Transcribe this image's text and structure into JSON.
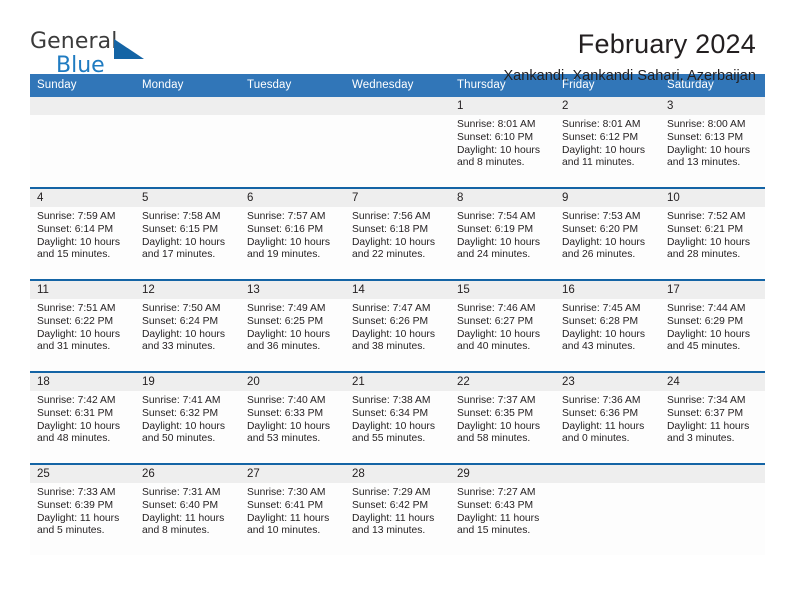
{
  "brand": {
    "line1": "General",
    "line2": "Blue",
    "triangle_color": "#1464a5",
    "blue_color": "#1f7bc1"
  },
  "header": {
    "title": "February 2024",
    "subtitle": "Xankandi, Xankandi Sahari, Azerbaijan"
  },
  "colors": {
    "header_blue": "#3176b8",
    "row_divider": "#1464a5",
    "daynum_band": "#eeeeee",
    "text": "#231f20"
  },
  "weekday_headers": [
    "Sunday",
    "Monday",
    "Tuesday",
    "Wednesday",
    "Thursday",
    "Friday",
    "Saturday"
  ],
  "weeks": [
    [
      {
        "day": "",
        "sunrise": "",
        "sunset": "",
        "daylight1": "",
        "daylight2": "",
        "blank": true
      },
      {
        "day": "",
        "sunrise": "",
        "sunset": "",
        "daylight1": "",
        "daylight2": "",
        "blank": true
      },
      {
        "day": "",
        "sunrise": "",
        "sunset": "",
        "daylight1": "",
        "daylight2": "",
        "blank": true
      },
      {
        "day": "",
        "sunrise": "",
        "sunset": "",
        "daylight1": "",
        "daylight2": "",
        "blank": true
      },
      {
        "day": "1",
        "sunrise": "Sunrise: 8:01 AM",
        "sunset": "Sunset: 6:10 PM",
        "daylight1": "Daylight: 10 hours",
        "daylight2": "and 8 minutes."
      },
      {
        "day": "2",
        "sunrise": "Sunrise: 8:01 AM",
        "sunset": "Sunset: 6:12 PM",
        "daylight1": "Daylight: 10 hours",
        "daylight2": "and 11 minutes."
      },
      {
        "day": "3",
        "sunrise": "Sunrise: 8:00 AM",
        "sunset": "Sunset: 6:13 PM",
        "daylight1": "Daylight: 10 hours",
        "daylight2": "and 13 minutes."
      }
    ],
    [
      {
        "day": "4",
        "sunrise": "Sunrise: 7:59 AM",
        "sunset": "Sunset: 6:14 PM",
        "daylight1": "Daylight: 10 hours",
        "daylight2": "and 15 minutes."
      },
      {
        "day": "5",
        "sunrise": "Sunrise: 7:58 AM",
        "sunset": "Sunset: 6:15 PM",
        "daylight1": "Daylight: 10 hours",
        "daylight2": "and 17 minutes."
      },
      {
        "day": "6",
        "sunrise": "Sunrise: 7:57 AM",
        "sunset": "Sunset: 6:16 PM",
        "daylight1": "Daylight: 10 hours",
        "daylight2": "and 19 minutes."
      },
      {
        "day": "7",
        "sunrise": "Sunrise: 7:56 AM",
        "sunset": "Sunset: 6:18 PM",
        "daylight1": "Daylight: 10 hours",
        "daylight2": "and 22 minutes."
      },
      {
        "day": "8",
        "sunrise": "Sunrise: 7:54 AM",
        "sunset": "Sunset: 6:19 PM",
        "daylight1": "Daylight: 10 hours",
        "daylight2": "and 24 minutes."
      },
      {
        "day": "9",
        "sunrise": "Sunrise: 7:53 AM",
        "sunset": "Sunset: 6:20 PM",
        "daylight1": "Daylight: 10 hours",
        "daylight2": "and 26 minutes."
      },
      {
        "day": "10",
        "sunrise": "Sunrise: 7:52 AM",
        "sunset": "Sunset: 6:21 PM",
        "daylight1": "Daylight: 10 hours",
        "daylight2": "and 28 minutes."
      }
    ],
    [
      {
        "day": "11",
        "sunrise": "Sunrise: 7:51 AM",
        "sunset": "Sunset: 6:22 PM",
        "daylight1": "Daylight: 10 hours",
        "daylight2": "and 31 minutes."
      },
      {
        "day": "12",
        "sunrise": "Sunrise: 7:50 AM",
        "sunset": "Sunset: 6:24 PM",
        "daylight1": "Daylight: 10 hours",
        "daylight2": "and 33 minutes."
      },
      {
        "day": "13",
        "sunrise": "Sunrise: 7:49 AM",
        "sunset": "Sunset: 6:25 PM",
        "daylight1": "Daylight: 10 hours",
        "daylight2": "and 36 minutes."
      },
      {
        "day": "14",
        "sunrise": "Sunrise: 7:47 AM",
        "sunset": "Sunset: 6:26 PM",
        "daylight1": "Daylight: 10 hours",
        "daylight2": "and 38 minutes."
      },
      {
        "day": "15",
        "sunrise": "Sunrise: 7:46 AM",
        "sunset": "Sunset: 6:27 PM",
        "daylight1": "Daylight: 10 hours",
        "daylight2": "and 40 minutes."
      },
      {
        "day": "16",
        "sunrise": "Sunrise: 7:45 AM",
        "sunset": "Sunset: 6:28 PM",
        "daylight1": "Daylight: 10 hours",
        "daylight2": "and 43 minutes."
      },
      {
        "day": "17",
        "sunrise": "Sunrise: 7:44 AM",
        "sunset": "Sunset: 6:29 PM",
        "daylight1": "Daylight: 10 hours",
        "daylight2": "and 45 minutes."
      }
    ],
    [
      {
        "day": "18",
        "sunrise": "Sunrise: 7:42 AM",
        "sunset": "Sunset: 6:31 PM",
        "daylight1": "Daylight: 10 hours",
        "daylight2": "and 48 minutes."
      },
      {
        "day": "19",
        "sunrise": "Sunrise: 7:41 AM",
        "sunset": "Sunset: 6:32 PM",
        "daylight1": "Daylight: 10 hours",
        "daylight2": "and 50 minutes."
      },
      {
        "day": "20",
        "sunrise": "Sunrise: 7:40 AM",
        "sunset": "Sunset: 6:33 PM",
        "daylight1": "Daylight: 10 hours",
        "daylight2": "and 53 minutes."
      },
      {
        "day": "21",
        "sunrise": "Sunrise: 7:38 AM",
        "sunset": "Sunset: 6:34 PM",
        "daylight1": "Daylight: 10 hours",
        "daylight2": "and 55 minutes."
      },
      {
        "day": "22",
        "sunrise": "Sunrise: 7:37 AM",
        "sunset": "Sunset: 6:35 PM",
        "daylight1": "Daylight: 10 hours",
        "daylight2": "and 58 minutes."
      },
      {
        "day": "23",
        "sunrise": "Sunrise: 7:36 AM",
        "sunset": "Sunset: 6:36 PM",
        "daylight1": "Daylight: 11 hours",
        "daylight2": "and 0 minutes."
      },
      {
        "day": "24",
        "sunrise": "Sunrise: 7:34 AM",
        "sunset": "Sunset: 6:37 PM",
        "daylight1": "Daylight: 11 hours",
        "daylight2": "and 3 minutes."
      }
    ],
    [
      {
        "day": "25",
        "sunrise": "Sunrise: 7:33 AM",
        "sunset": "Sunset: 6:39 PM",
        "daylight1": "Daylight: 11 hours",
        "daylight2": "and 5 minutes."
      },
      {
        "day": "26",
        "sunrise": "Sunrise: 7:31 AM",
        "sunset": "Sunset: 6:40 PM",
        "daylight1": "Daylight: 11 hours",
        "daylight2": "and 8 minutes."
      },
      {
        "day": "27",
        "sunrise": "Sunrise: 7:30 AM",
        "sunset": "Sunset: 6:41 PM",
        "daylight1": "Daylight: 11 hours",
        "daylight2": "and 10 minutes."
      },
      {
        "day": "28",
        "sunrise": "Sunrise: 7:29 AM",
        "sunset": "Sunset: 6:42 PM",
        "daylight1": "Daylight: 11 hours",
        "daylight2": "and 13 minutes."
      },
      {
        "day": "29",
        "sunrise": "Sunrise: 7:27 AM",
        "sunset": "Sunset: 6:43 PM",
        "daylight1": "Daylight: 11 hours",
        "daylight2": "and 15 minutes."
      },
      {
        "day": "",
        "sunrise": "",
        "sunset": "",
        "daylight1": "",
        "daylight2": "",
        "blank": true
      },
      {
        "day": "",
        "sunrise": "",
        "sunset": "",
        "daylight1": "",
        "daylight2": "",
        "blank": true
      }
    ]
  ]
}
